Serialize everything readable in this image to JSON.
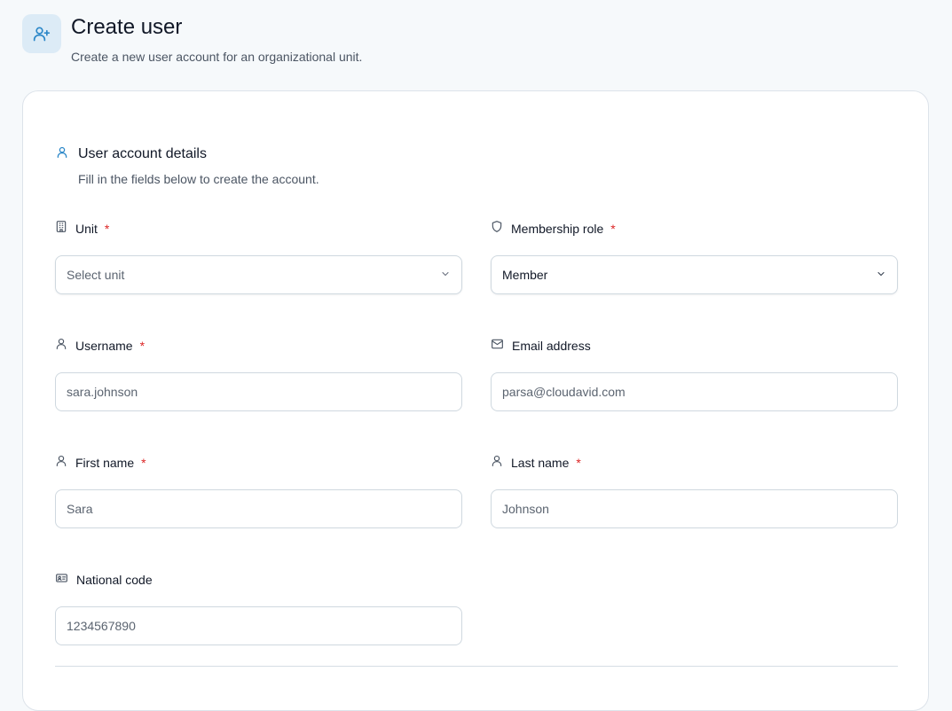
{
  "header": {
    "icon": "user-plus-icon",
    "title": "Create user",
    "subtitle": "Create a new user account for an organizational unit."
  },
  "section": {
    "icon": "user-icon",
    "title": "User account details",
    "description": "Fill in the fields below to create the account."
  },
  "required_mark": "*",
  "fields": {
    "unit": {
      "label": "Unit",
      "icon": "building-icon",
      "required": true,
      "value": "Select unit"
    },
    "role": {
      "label": "Membership role",
      "icon": "shield-icon",
      "required": true,
      "value": "Member"
    },
    "username": {
      "label": "Username",
      "icon": "user-icon",
      "required": true,
      "value": "sara.johnson"
    },
    "email": {
      "label": "Email address",
      "icon": "mail-icon",
      "required": false,
      "value": "parsa@cloudavid.com"
    },
    "first_name": {
      "label": "First name",
      "icon": "user-icon",
      "required": true,
      "value": "Sara"
    },
    "last_name": {
      "label": "Last name",
      "icon": "user-icon",
      "required": true,
      "value": "Johnson"
    },
    "national_code": {
      "label": "National code",
      "icon": "id-card-icon",
      "required": false,
      "value": "1234567890"
    }
  },
  "colors": {
    "accent": "#2b87c8",
    "required": "#dc2626"
  }
}
